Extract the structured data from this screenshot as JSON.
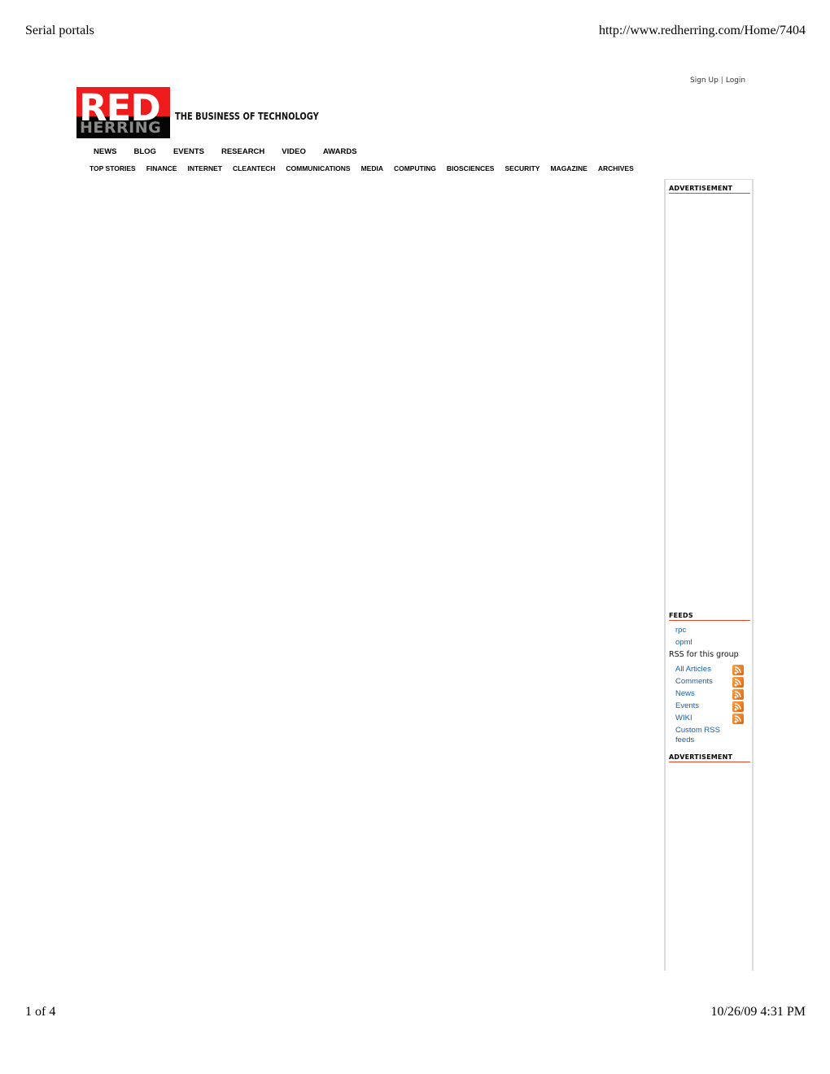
{
  "print": {
    "title": "Serial portals",
    "url": "http://www.redherring.com/Home/7404",
    "page_indicator": "1 of 4",
    "timestamp": "10/26/09 4:31 PM"
  },
  "account": {
    "sign_up": "Sign Up",
    "separator": "|",
    "login": "Login"
  },
  "brand": {
    "logo_top": "RED",
    "logo_bottom": "HERRING",
    "tagline": "THE BUSINESS OF TECHNOLOGY",
    "colors": {
      "red": "#ee1c1c",
      "black": "#050505",
      "herring_gray": "#8a8a8a"
    }
  },
  "nav": {
    "primary": [
      {
        "label": "NEWS"
      },
      {
        "label": "BLOG"
      },
      {
        "label": "EVENTS"
      },
      {
        "label": "RESEARCH"
      },
      {
        "label": "VIDEO"
      },
      {
        "label": "AWARDS"
      }
    ],
    "secondary": [
      {
        "label": "TOP STORIES"
      },
      {
        "label": "FINANCE"
      },
      {
        "label": "INTERNET"
      },
      {
        "label": "CLEANTECH"
      },
      {
        "label": "COMMUNICATIONS"
      },
      {
        "label": "MEDIA"
      },
      {
        "label": "COMPUTING"
      },
      {
        "label": "BIOSCIENCES"
      },
      {
        "label": "SECURITY"
      },
      {
        "label": "MAGAZINE"
      },
      {
        "label": "ARCHIVES"
      }
    ]
  },
  "sidebar": {
    "advertisement_top": "ADVERTISEMENT",
    "feeds": {
      "heading": "FEEDS",
      "links": [
        {
          "label": "rpc"
        },
        {
          "label": "opml"
        }
      ],
      "rss_group_label": "RSS for this group",
      "rss_items": [
        {
          "label": "All Articles",
          "icon": "rss-icon"
        },
        {
          "label": "Comments",
          "icon": "rss-icon"
        },
        {
          "label": "News",
          "icon": "rss-icon"
        },
        {
          "label": "Events",
          "icon": "rss-icon"
        },
        {
          "label": "WIKI",
          "icon": "rss-icon"
        }
      ],
      "custom_rss_line1": "Custom RSS",
      "custom_rss_line2": "feeds"
    },
    "advertisement_bottom": "ADVERTISEMENT",
    "colors": {
      "link": "#1a5fa8",
      "heading_rule": "#d84a2a",
      "rss_orange": "#f07a1e"
    }
  }
}
